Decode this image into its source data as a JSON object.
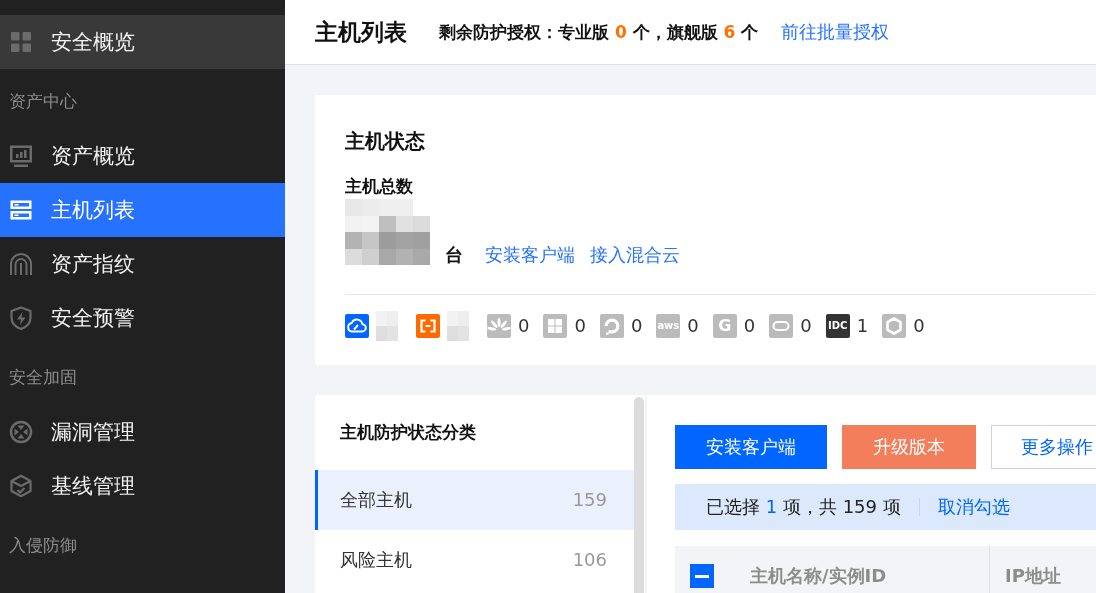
{
  "sidebar": {
    "top_item": {
      "label": "安全概览",
      "highlighted": true
    },
    "groups": [
      {
        "title": "资产中心",
        "items": [
          {
            "label": "资产概览",
            "selected": false
          },
          {
            "label": "主机列表",
            "selected": true
          },
          {
            "label": "资产指纹",
            "selected": false
          },
          {
            "label": "安全预警",
            "selected": false
          }
        ]
      },
      {
        "title": "安全加固",
        "items": [
          {
            "label": "漏洞管理",
            "selected": false
          },
          {
            "label": "基线管理",
            "selected": false
          }
        ]
      },
      {
        "title": "入侵防御"
      }
    ]
  },
  "header": {
    "title": "主机列表",
    "quota": {
      "prefix": "剩余防护授权：专业版",
      "pro_count": "0",
      "middle": "个，旗舰版",
      "flagship_count": "6",
      "suffix": "个"
    },
    "link": "前往批量授权"
  },
  "host_status": {
    "title": "主机状态",
    "total_label": "主机总数",
    "total_redacted": true,
    "unit": "台",
    "links": [
      "安装客户端",
      "接入混合云"
    ],
    "providers": [
      {
        "color": "#0066ff",
        "redacted": true
      },
      {
        "color": "#ff6a00",
        "redacted": true
      },
      {
        "color": "#bbbbbb",
        "redacted": false,
        "count": "0"
      },
      {
        "color": "#bbbbbb",
        "redacted": false,
        "count": "0"
      },
      {
        "color": "#bbbbbb",
        "redacted": false,
        "count": "0"
      },
      {
        "color": "#bbbbbb",
        "badge": "aws",
        "redacted": false,
        "count": "0"
      },
      {
        "color": "#bbbbbb",
        "badge": "G",
        "redacted": false,
        "count": "0"
      },
      {
        "color": "#bbbbbb",
        "redacted": false,
        "count": "0"
      },
      {
        "color": "#333333",
        "badge": "IDC",
        "redacted": false,
        "count": "1"
      },
      {
        "color": "#bbbbbb",
        "redacted": false,
        "count": "0"
      }
    ]
  },
  "categories": {
    "title": "主机防护状态分类",
    "items": [
      {
        "label": "全部主机",
        "count": "159",
        "selected": true
      },
      {
        "label": "风险主机",
        "count": "106",
        "selected": false
      }
    ]
  },
  "toolbar": {
    "buttons": [
      {
        "label": "安装客户端",
        "kind": "primary"
      },
      {
        "label": "升级版本",
        "kind": "warning"
      },
      {
        "label": "更多操作",
        "kind": "outline"
      }
    ]
  },
  "selection_bar": {
    "prefix": "已选择",
    "count": "1",
    "suffix": "项，共 159 项",
    "link": "取消勾选"
  },
  "table": {
    "select_all": {
      "indeterminate": true
    },
    "columns": [
      "主机名称/实例ID",
      "IP地址"
    ]
  }
}
